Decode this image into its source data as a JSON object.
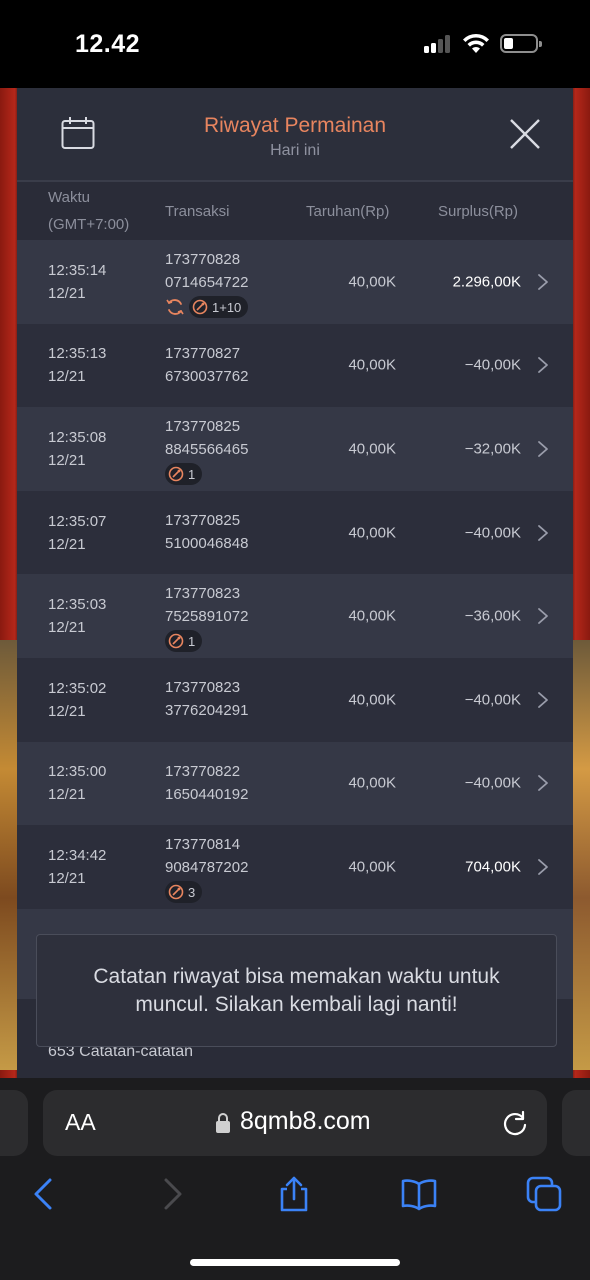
{
  "status_bar": {
    "time": "12.42"
  },
  "modal": {
    "title": "Riwayat Permainan",
    "subtitle": "Hari ini"
  },
  "table": {
    "headers": {
      "time_line1": "Waktu",
      "time_line2": "(GMT+7:00)",
      "transaction": "Transaksi",
      "bet": "Taruhan(Rp)",
      "surplus": "Surplus(Rp)"
    },
    "rows": [
      {
        "time": "12:35:14",
        "date": "12/21",
        "tx1": "173770828",
        "tx2": "0714654722",
        "bet": "40,00K",
        "surplus": "2.296,00K",
        "badge": "1+10",
        "refresh": true
      },
      {
        "time": "12:35:13",
        "date": "12/21",
        "tx1": "173770827",
        "tx2": "6730037762",
        "bet": "40,00K",
        "surplus": "−40,00K",
        "badge": "",
        "refresh": false
      },
      {
        "time": "12:35:08",
        "date": "12/21",
        "tx1": "173770825",
        "tx2": "8845566465",
        "bet": "40,00K",
        "surplus": "−32,00K",
        "badge": "1",
        "refresh": false
      },
      {
        "time": "12:35:07",
        "date": "12/21",
        "tx1": "173770825",
        "tx2": "5100046848",
        "bet": "40,00K",
        "surplus": "−40,00K",
        "badge": "",
        "refresh": false
      },
      {
        "time": "12:35:03",
        "date": "12/21",
        "tx1": "173770823",
        "tx2": "7525891072",
        "bet": "40,00K",
        "surplus": "−36,00K",
        "badge": "1",
        "refresh": false
      },
      {
        "time": "12:35:02",
        "date": "12/21",
        "tx1": "173770823",
        "tx2": "3776204291",
        "bet": "40,00K",
        "surplus": "−40,00K",
        "badge": "",
        "refresh": false
      },
      {
        "time": "12:35:00",
        "date": "12/21",
        "tx1": "173770822",
        "tx2": "1650440192",
        "bet": "40,00K",
        "surplus": "−40,00K",
        "badge": "",
        "refresh": false
      },
      {
        "time": "12:34:42",
        "date": "12/21",
        "tx1": "173770814",
        "tx2": "9084787202",
        "bet": "40,00K",
        "surplus": "704,00K",
        "badge": "3",
        "refresh": false
      }
    ]
  },
  "footer": {
    "count_text": "653 Catatan-catatan"
  },
  "toast": {
    "message": "Catatan riwayat bisa memakan waktu untuk muncul. Silakan kembali lagi nanti!"
  },
  "safari": {
    "text_size_label": "AA",
    "url": "8qmb8.com"
  },
  "colors": {
    "title_accent": "#e8855f",
    "background": "#2a2c38",
    "win": "#ffffff"
  }
}
